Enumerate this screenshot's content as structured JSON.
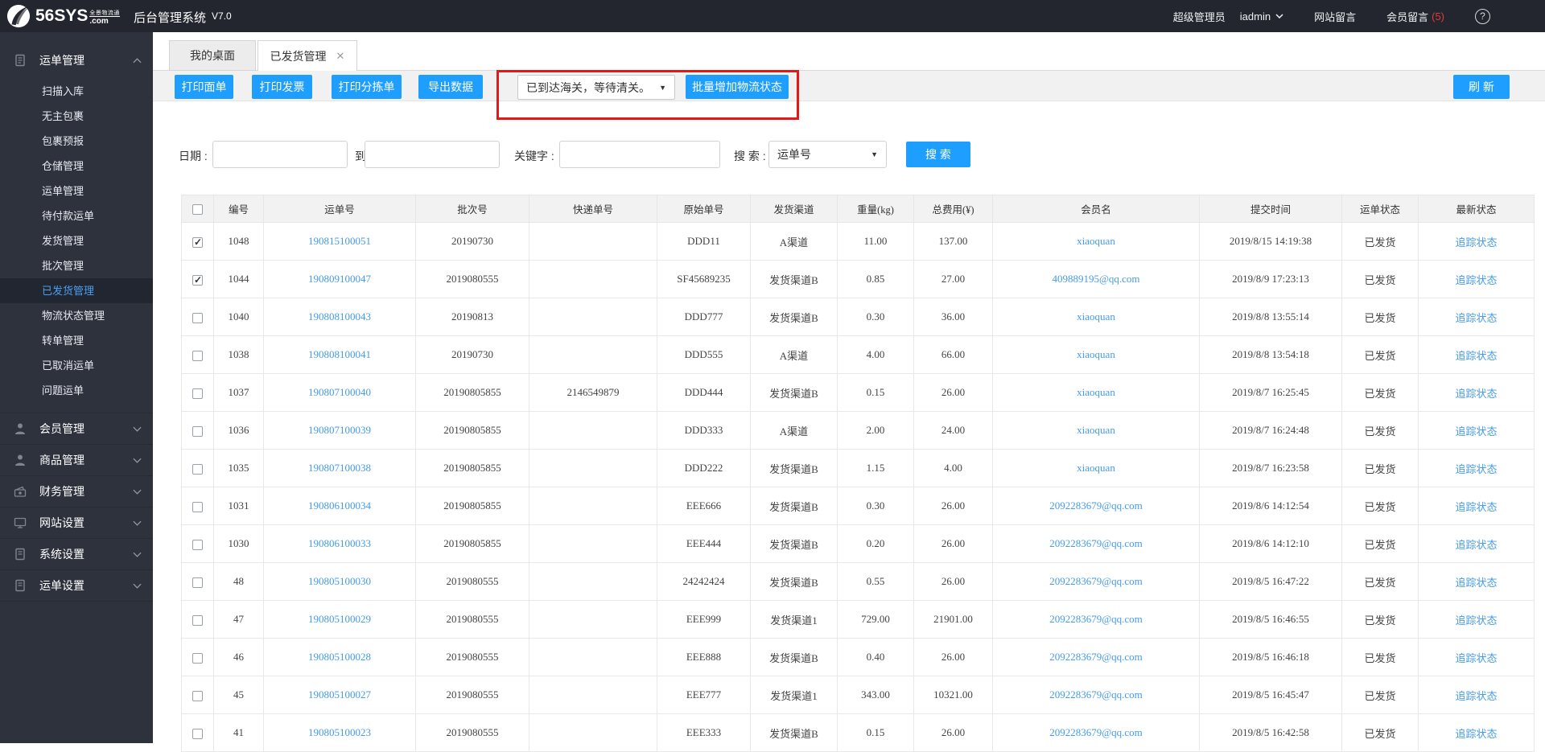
{
  "topbar": {
    "logo_main": "56SYS",
    "logo_sub_top": "全景物流通",
    "logo_sub_bottom": ".com",
    "app_title": "后台管理系统",
    "version": "V7.0",
    "role": "超级管理员",
    "username": "iadmin",
    "site_messages": "网站留言",
    "member_messages": "会员留言",
    "member_message_count": "(5)",
    "help": "?"
  },
  "sidebar": {
    "sections": [
      {
        "label": "运单管理",
        "icon": "waybill",
        "expanded": true,
        "items": [
          "扫描入库",
          "无主包裹",
          "包裹预报",
          "仓储管理",
          "运单管理",
          "待付款运单",
          "发货管理",
          "批次管理",
          "已发货管理",
          "物流状态管理",
          "转单管理",
          "已取消运单",
          "问题运单"
        ],
        "active_item": "已发货管理"
      },
      {
        "label": "会员管理",
        "icon": "member",
        "expanded": false
      },
      {
        "label": "商品管理",
        "icon": "goods",
        "expanded": false
      },
      {
        "label": "财务管理",
        "icon": "finance",
        "expanded": false
      },
      {
        "label": "网站设置",
        "icon": "site",
        "expanded": false
      },
      {
        "label": "系统设置",
        "icon": "system",
        "expanded": false
      },
      {
        "label": "运单设置",
        "icon": "waybill2",
        "expanded": false
      }
    ]
  },
  "tabs": [
    {
      "label": "我的桌面",
      "active": false,
      "closable": false
    },
    {
      "label": "已发货管理",
      "active": true,
      "closable": true
    }
  ],
  "toolbar": {
    "buttons": [
      "打印面单",
      "打印发票",
      "打印分拣单",
      "导出数据"
    ],
    "status_select_value": "已到达海关，等待清关。",
    "batch_button": "批量增加物流状态",
    "refresh_button": "刷 新"
  },
  "search": {
    "date_label": "日期 :",
    "to_label": "到",
    "keyword_label": "关键字 :",
    "search_by_label": "搜 索 :",
    "search_select_value": "运单号",
    "search_button": "搜 索",
    "date_from_value": "",
    "date_to_value": "",
    "keyword_value": ""
  },
  "table": {
    "columns": [
      "编号",
      "运单号",
      "批次号",
      "快递单号",
      "原始单号",
      "发货渠道",
      "重量(kg)",
      "总费用(¥)",
      "会员名",
      "提交时间",
      "运单状态",
      "最新状态"
    ],
    "rows": [
      {
        "checked": true,
        "id": "1048",
        "waybill": "190815100051",
        "batch": "20190730",
        "express": "",
        "original": "DDD11",
        "channel": "A渠道",
        "weight": "11.00",
        "fee": "137.00",
        "member": "xiaoquan",
        "time": "2019/8/15 14:19:38",
        "status": "已发货",
        "track": "追踪状态"
      },
      {
        "checked": true,
        "id": "1044",
        "waybill": "190809100047",
        "batch": "2019080555",
        "express": "",
        "original": "SF45689235",
        "channel": "发货渠道B",
        "weight": "0.85",
        "fee": "27.00",
        "member": "409889195@qq.com",
        "time": "2019/8/9 17:23:13",
        "status": "已发货",
        "track": "追踪状态"
      },
      {
        "checked": false,
        "id": "1040",
        "waybill": "190808100043",
        "batch": "20190813",
        "express": "",
        "original": "DDD777",
        "channel": "发货渠道B",
        "weight": "0.30",
        "fee": "36.00",
        "member": "xiaoquan",
        "time": "2019/8/8 13:55:14",
        "status": "已发货",
        "track": "追踪状态"
      },
      {
        "checked": false,
        "id": "1038",
        "waybill": "190808100041",
        "batch": "20190730",
        "express": "",
        "original": "DDD555",
        "channel": "A渠道",
        "weight": "4.00",
        "fee": "66.00",
        "member": "xiaoquan",
        "time": "2019/8/8 13:54:18",
        "status": "已发货",
        "track": "追踪状态"
      },
      {
        "checked": false,
        "id": "1037",
        "waybill": "190807100040",
        "batch": "20190805855",
        "express": "2146549879",
        "original": "DDD444",
        "channel": "发货渠道B",
        "weight": "0.15",
        "fee": "26.00",
        "member": "xiaoquan",
        "time": "2019/8/7 16:25:45",
        "status": "已发货",
        "track": "追踪状态"
      },
      {
        "checked": false,
        "id": "1036",
        "waybill": "190807100039",
        "batch": "20190805855",
        "express": "",
        "original": "DDD333",
        "channel": "A渠道",
        "weight": "2.00",
        "fee": "24.00",
        "member": "xiaoquan",
        "time": "2019/8/7 16:24:48",
        "status": "已发货",
        "track": "追踪状态"
      },
      {
        "checked": false,
        "id": "1035",
        "waybill": "190807100038",
        "batch": "20190805855",
        "express": "",
        "original": "DDD222",
        "channel": "发货渠道B",
        "weight": "1.15",
        "fee": "4.00",
        "member": "xiaoquan",
        "time": "2019/8/7 16:23:58",
        "status": "已发货",
        "track": "追踪状态"
      },
      {
        "checked": false,
        "id": "1031",
        "waybill": "190806100034",
        "batch": "20190805855",
        "express": "",
        "original": "EEE666",
        "channel": "发货渠道B",
        "weight": "0.30",
        "fee": "26.00",
        "member": "2092283679@qq.com",
        "time": "2019/8/6 14:12:54",
        "status": "已发货",
        "track": "追踪状态"
      },
      {
        "checked": false,
        "id": "1030",
        "waybill": "190806100033",
        "batch": "20190805855",
        "express": "",
        "original": "EEE444",
        "channel": "发货渠道B",
        "weight": "0.20",
        "fee": "26.00",
        "member": "2092283679@qq.com",
        "time": "2019/8/6 14:12:10",
        "status": "已发货",
        "track": "追踪状态"
      },
      {
        "checked": false,
        "id": "48",
        "waybill": "190805100030",
        "batch": "2019080555",
        "express": "",
        "original": "24242424",
        "channel": "发货渠道B",
        "weight": "0.55",
        "fee": "26.00",
        "member": "2092283679@qq.com",
        "time": "2019/8/5 16:47:22",
        "status": "已发货",
        "track": "追踪状态"
      },
      {
        "checked": false,
        "id": "47",
        "waybill": "190805100029",
        "batch": "2019080555",
        "express": "",
        "original": "EEE999",
        "channel": "发货渠道1",
        "weight": "729.00",
        "fee": "21901.00",
        "member": "2092283679@qq.com",
        "time": "2019/8/5 16:46:55",
        "status": "已发货",
        "track": "追踪状态"
      },
      {
        "checked": false,
        "id": "46",
        "waybill": "190805100028",
        "batch": "2019080555",
        "express": "",
        "original": "EEE888",
        "channel": "发货渠道B",
        "weight": "0.40",
        "fee": "26.00",
        "member": "2092283679@qq.com",
        "time": "2019/8/5 16:46:18",
        "status": "已发货",
        "track": "追踪状态"
      },
      {
        "checked": false,
        "id": "45",
        "waybill": "190805100027",
        "batch": "2019080555",
        "express": "",
        "original": "EEE777",
        "channel": "发货渠道1",
        "weight": "343.00",
        "fee": "10321.00",
        "member": "2092283679@qq.com",
        "time": "2019/8/5 16:45:47",
        "status": "已发货",
        "track": "追踪状态"
      },
      {
        "checked": false,
        "id": "41",
        "waybill": "190805100023",
        "batch": "2019080555",
        "express": "",
        "original": "EEE333",
        "channel": "发货渠道B",
        "weight": "0.15",
        "fee": "26.00",
        "member": "2092283679@qq.com",
        "time": "2019/8/5 16:42:58",
        "status": "已发货",
        "track": "追踪状态"
      }
    ]
  }
}
